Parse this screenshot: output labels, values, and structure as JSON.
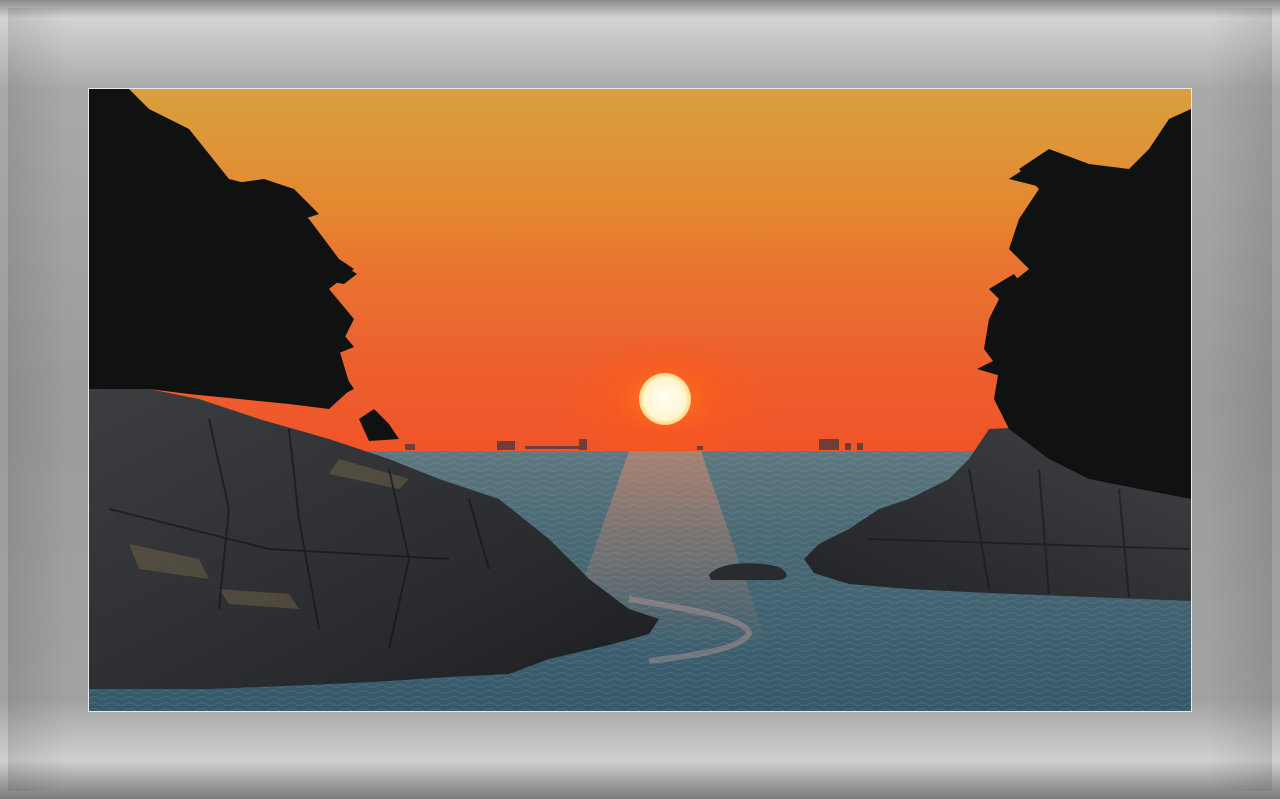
{
  "scene": {
    "subject": "sunset-over-sea-cove",
    "colors": {
      "sky_top": "#d99a3a",
      "sky_mid": "#e67a2c",
      "sky_horizon": "#f0542a",
      "sun": "#fffbe8",
      "sun_glow": "#ff6a1a",
      "sea_far": "#4d6a78",
      "sea_near": "#3a5f70",
      "rock": "#2a2a2c",
      "trees": "#121210",
      "frame": "#a8a8a8"
    }
  }
}
